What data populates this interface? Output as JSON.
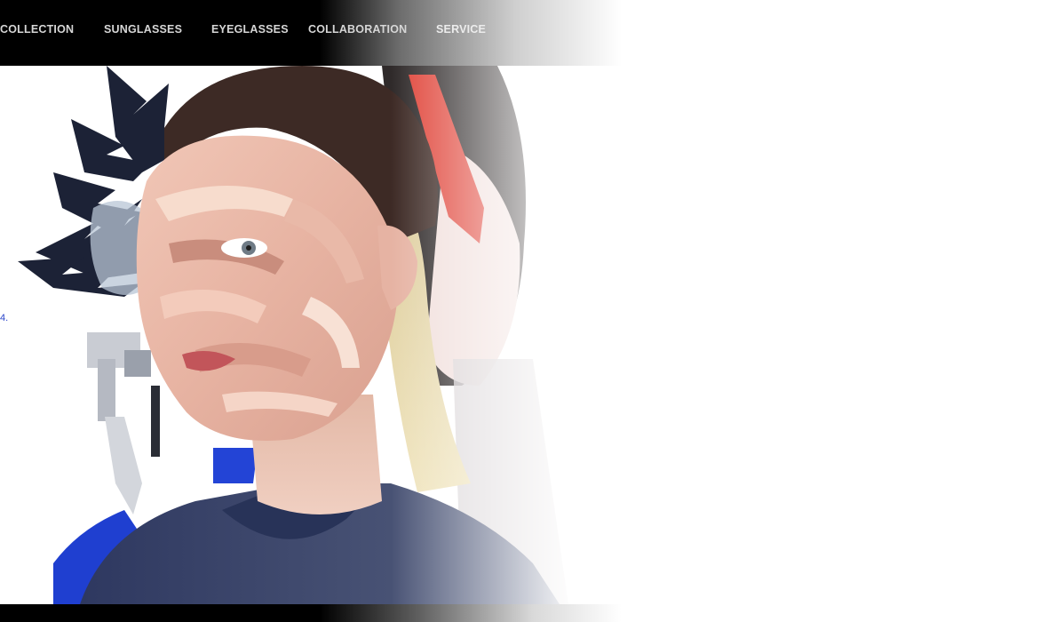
{
  "nav": {
    "items": [
      {
        "label": "COLLECTION"
      },
      {
        "label": "SUNGLASSES"
      },
      {
        "label": "EYEGLASSES"
      },
      {
        "label": "COLLABORATION"
      },
      {
        "label": "SERVICE"
      }
    ]
  },
  "hero": {
    "edge_mark": "4."
  },
  "colors": {
    "nav_bg": "#000000",
    "nav_text": "#d6d6d6",
    "page_bg": "#ffffff",
    "accent_red": "#e0453a",
    "jacket_navy": "#3f4a6e",
    "blue_panel": "#1f3fd0"
  }
}
